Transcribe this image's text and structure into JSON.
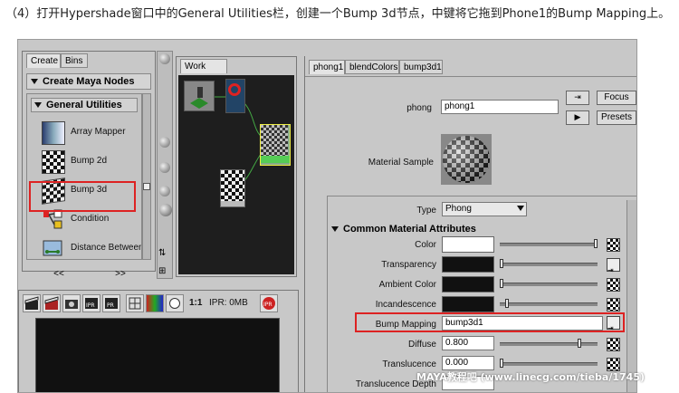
{
  "caption": "（4）打开Hypershade窗口中的General Utilities栏，创建一个Bump 3d节点，中键将它拖到Phone1的Bump Mapping上。",
  "left_panel": {
    "tabs": [
      "Create",
      "Bins"
    ],
    "create_header": "Create Maya Nodes",
    "section": "General Utilities",
    "nodes": [
      "Array Mapper",
      "Bump 2d",
      "Bump 3d",
      "Condition",
      "Distance Between"
    ],
    "scroll_left": "<<",
    "scroll_right": ">>"
  },
  "work_area": {
    "tab": "Work Area"
  },
  "attr_editor": {
    "tabs": [
      "phong1",
      "blendColors",
      "bump3d1"
    ],
    "type_label": "phong",
    "name_value": "phong1",
    "focus_button": "Focus",
    "presets_button": "Presets",
    "material_sample_label": "Material Sample",
    "type_field_label": "Type",
    "type_value": "Phong",
    "section": "Common Material Attributes",
    "rows": [
      {
        "label": "Color",
        "value": ""
      },
      {
        "label": "Transparency",
        "value": ""
      },
      {
        "label": "Ambient Color",
        "value": ""
      },
      {
        "label": "Incandescence",
        "value": ""
      },
      {
        "label": "Bump Mapping",
        "value": "bump3d1"
      },
      {
        "label": "Diffuse",
        "value": "0.800"
      },
      {
        "label": "Translucence",
        "value": "0.000"
      },
      {
        "label": "Translucence Depth",
        "value": ""
      }
    ]
  },
  "render_toolbar": {
    "ratio": "1:1",
    "ipr_label": "IPR: 0MB"
  },
  "watermark": "MAYA教程吧  (www.linecg.com/tieba/1745)",
  "colors": {
    "accent_red": "#d22222",
    "panel_bg": "#c8c8c8",
    "work_area_bg": "#1e1e1e"
  }
}
